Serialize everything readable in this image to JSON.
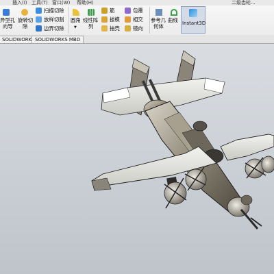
{
  "menubar": {
    "items": [
      "插入(I)",
      "工具(T)",
      "窗口(W)",
      "帮助(H)"
    ],
    "doc_title": "二级齿轮..."
  },
  "ribbon": {
    "hole_wizard": [
      "异型孔",
      "向导"
    ],
    "revolve_cut": [
      "旋转切",
      "除"
    ],
    "sweep_cut": "扫描切除",
    "loft_cut": "放样切割",
    "boundary_cut": "边界切除",
    "fillet": "圆角",
    "linear_pattern": [
      "线性阵",
      "列"
    ],
    "rib": "筋",
    "draft": "拔模",
    "shell": "抽壳",
    "wrap": "包覆",
    "intersect": "相交",
    "mirror": "镜向",
    "reference_geometry": [
      "参考几",
      "何体"
    ],
    "curves": "曲线",
    "instant3d": "Instant3D"
  },
  "tabs": [
    "SOLIDWORKS 插件",
    "SOLIDWORKS MBD"
  ],
  "headsup_icons": [
    "zoom-to-fit-icon",
    "zoom-area-icon",
    "previous-view-icon",
    "section-view-icon",
    "view-orientation-icon",
    "display-style-icon",
    "hide-show-icon",
    "edit-appearance-icon",
    "apply-scene-icon",
    "view-settings-icon",
    "monitor-icon"
  ],
  "colors": {
    "viewport_top": "#d9dde2",
    "viewport_bottom": "#bfc4cb",
    "instant3d_bg": "#d4dbe6",
    "aircraft_body": "#8a8272"
  }
}
